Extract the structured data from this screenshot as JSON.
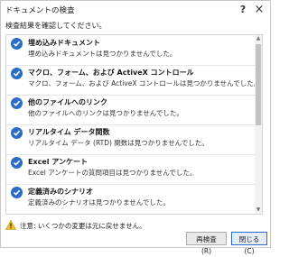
{
  "window": {
    "title": "ドキュメントの検査",
    "help_glyph": "?",
    "close_glyph": "×"
  },
  "subtitle": "検査結果を確認してください。",
  "results": [
    {
      "title": "埋め込みドキュメント",
      "description": "埋め込みドキュメントは見つかりませんでした。"
    },
    {
      "title": "マクロ、フォーム、および ActiveX コントロール",
      "description": "マクロ、フォーム、および ActiveX コントロールは見つかりませんでした。"
    },
    {
      "title": "他のファイルへのリンク",
      "description": "他のファイルへのリンクは見つかりませんでした。"
    },
    {
      "title": "リアルタイム データ関数",
      "description": "リアルタイム データ (RTD) 関数は見つかりませんでした。"
    },
    {
      "title": "Excel アンケート",
      "description": "Excel アンケートの質問項目は見つかりませんでした。"
    },
    {
      "title": "定義済みのシナリオ",
      "description": "定義済みのシナリオは見つかりませんでした。"
    }
  ],
  "warning": "注意: いくつかの変更は元に戻せません。",
  "buttons": {
    "recheck": "再検査(R)",
    "close": "閉じる(C)"
  },
  "colors": {
    "check_icon": "#2b6cc4",
    "warning_icon": "#f2c12e"
  }
}
